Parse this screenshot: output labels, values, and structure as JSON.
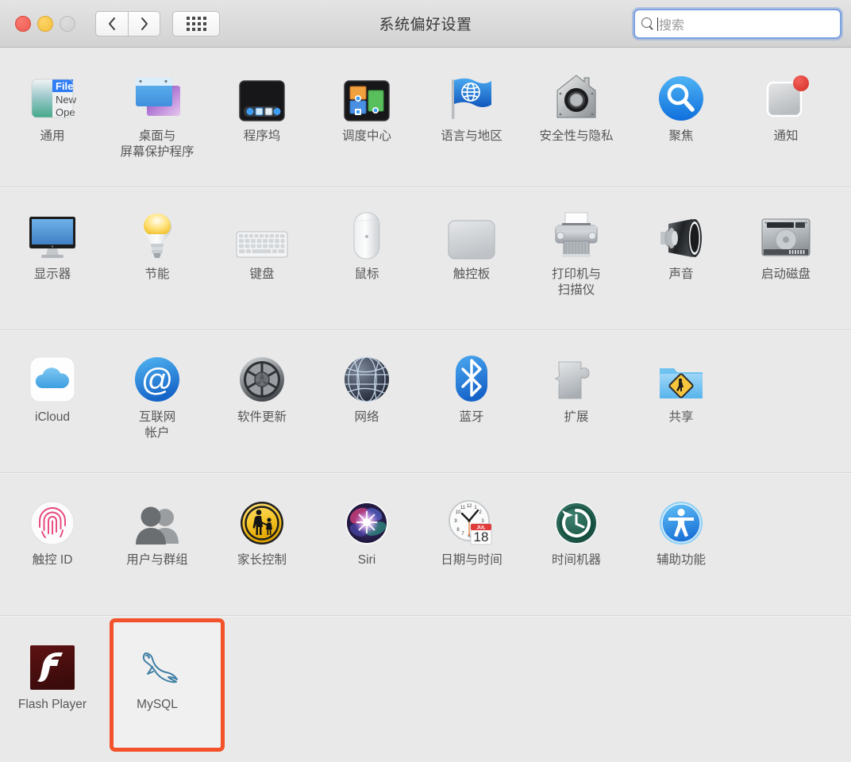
{
  "window": {
    "title": "系统偏好设置",
    "traffic_lights": [
      {
        "name": "close",
        "color": "#ec5a51",
        "enabled": true
      },
      {
        "name": "minimize",
        "color": "#f4c03c",
        "enabled": true
      },
      {
        "name": "zoom",
        "color": "#cfcfcf",
        "enabled": false
      }
    ],
    "nav": {
      "back_label": "‹",
      "forward_label": "›",
      "grid_label": "show-all"
    }
  },
  "search": {
    "placeholder": "搜索",
    "value": "",
    "focused": true,
    "focus_ring_color": "#7da2e0"
  },
  "selection": {
    "target": "MySQL",
    "highlight_color": "#f4522b"
  },
  "rows": [
    {
      "id": "row-personal",
      "panes": [
        {
          "id": "general",
          "label": "通用",
          "icon": "general-icon"
        },
        {
          "id": "desktop-saver",
          "label": "桌面与\n屏幕保护程序",
          "icon": "desktop-screensaver-icon"
        },
        {
          "id": "dock",
          "label": "程序坞",
          "icon": "dock-icon"
        },
        {
          "id": "mission-control",
          "label": "调度中心",
          "icon": "mission-control-icon"
        },
        {
          "id": "language-region",
          "label": "语言与地区",
          "icon": "language-region-icon"
        },
        {
          "id": "security",
          "label": "安全性与隐私",
          "icon": "security-privacy-icon"
        },
        {
          "id": "spotlight",
          "label": "聚焦",
          "icon": "spotlight-icon"
        },
        {
          "id": "notifications",
          "label": "通知",
          "icon": "notifications-icon"
        }
      ]
    },
    {
      "id": "row-hardware",
      "panes": [
        {
          "id": "displays",
          "label": "显示器",
          "icon": "displays-icon"
        },
        {
          "id": "energy-saver",
          "label": "节能",
          "icon": "energy-saver-icon"
        },
        {
          "id": "keyboard",
          "label": "键盘",
          "icon": "keyboard-icon"
        },
        {
          "id": "mouse",
          "label": "鼠标",
          "icon": "mouse-icon"
        },
        {
          "id": "trackpad",
          "label": "触控板",
          "icon": "trackpad-icon"
        },
        {
          "id": "printers",
          "label": "打印机与\n扫描仪",
          "icon": "printers-scanners-icon"
        },
        {
          "id": "sound",
          "label": "声音",
          "icon": "sound-icon"
        },
        {
          "id": "startup-disk",
          "label": "启动磁盘",
          "icon": "startup-disk-icon"
        }
      ]
    },
    {
      "id": "row-internet",
      "panes": [
        {
          "id": "icloud",
          "label": "iCloud",
          "icon": "icloud-icon"
        },
        {
          "id": "internet-accounts",
          "label": "互联网\n帐户",
          "icon": "internet-accounts-icon"
        },
        {
          "id": "software-update",
          "label": "软件更新",
          "icon": "software-update-icon"
        },
        {
          "id": "network",
          "label": "网络",
          "icon": "network-icon"
        },
        {
          "id": "bluetooth",
          "label": "蓝牙",
          "icon": "bluetooth-icon"
        },
        {
          "id": "extensions",
          "label": "扩展",
          "icon": "extensions-icon"
        },
        {
          "id": "sharing",
          "label": "共享",
          "icon": "sharing-icon"
        }
      ]
    },
    {
      "id": "row-system",
      "panes": [
        {
          "id": "touch-id",
          "label": "触控 ID",
          "icon": "touch-id-icon"
        },
        {
          "id": "users-groups",
          "label": "用户与群组",
          "icon": "users-groups-icon"
        },
        {
          "id": "parental",
          "label": "家长控制",
          "icon": "parental-controls-icon"
        },
        {
          "id": "siri",
          "label": "Siri",
          "icon": "siri-icon"
        },
        {
          "id": "date-time",
          "label": "日期与时间",
          "icon": "date-time-icon"
        },
        {
          "id": "time-machine",
          "label": "时间机器",
          "icon": "time-machine-icon"
        },
        {
          "id": "accessibility",
          "label": "辅助功能",
          "icon": "accessibility-icon"
        }
      ]
    },
    {
      "id": "row-third-party",
      "panes": [
        {
          "id": "flash-player",
          "label": "Flash Player",
          "icon": "flash-player-icon"
        },
        {
          "id": "mysql",
          "label": "MySQL",
          "icon": "mysql-dolphin-icon",
          "selected": true
        }
      ]
    }
  ],
  "date_time_icon": {
    "month": "JUL",
    "day": "18"
  },
  "general_icon": {
    "menu_items": [
      "File",
      "New",
      "Open"
    ]
  }
}
